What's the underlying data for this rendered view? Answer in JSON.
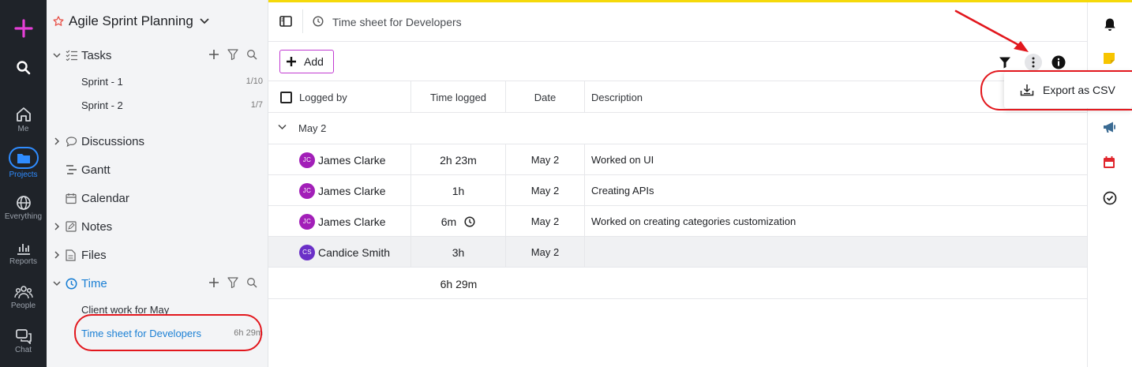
{
  "rail": [
    {
      "id": "new",
      "label": ""
    },
    {
      "id": "search",
      "label": ""
    },
    {
      "id": "me",
      "label": "Me"
    },
    {
      "id": "projects",
      "label": "Projects"
    },
    {
      "id": "everything",
      "label": "Everything"
    },
    {
      "id": "reports",
      "label": "Reports"
    },
    {
      "id": "people",
      "label": "People"
    },
    {
      "id": "chat",
      "label": "Chat"
    }
  ],
  "sidebar": {
    "project_title": "Agile Sprint Planning",
    "tasks_label": "Tasks",
    "sprint1": {
      "label": "Sprint - 1",
      "count": "1/10"
    },
    "sprint2": {
      "label": "Sprint - 2",
      "count": "1/7"
    },
    "discussions_label": "Discussions",
    "gantt_label": "Gantt",
    "calendar_label": "Calendar",
    "notes_label": "Notes",
    "files_label": "Files",
    "time_label": "Time",
    "time_items": [
      {
        "label": "Client work for May",
        "count": ""
      },
      {
        "label": "Time sheet for Developers",
        "count": "6h 29m"
      }
    ]
  },
  "main": {
    "breadcrumb_title": "Time sheet for Developers",
    "add_label": "Add",
    "columns": {
      "logged_by": "Logged by",
      "time_logged": "Time logged",
      "date": "Date",
      "description": "Description"
    },
    "group_label": "May 2",
    "rows": [
      {
        "initials": "JC",
        "name": "James Clarke",
        "time": "2h 23m",
        "date": "May 2",
        "description": "Worked on UI"
      },
      {
        "initials": "JC",
        "name": "James Clarke",
        "time": "1h",
        "date": "May 2",
        "description": "Creating APIs"
      },
      {
        "initials": "JC",
        "name": "James Clarke",
        "time": "6m",
        "date": "May 2",
        "description": "Worked on creating categories customization"
      },
      {
        "initials": "CS",
        "name": "Candice Smith",
        "time": "3h",
        "date": "May 2",
        "description": ""
      }
    ],
    "total": "6h 29m"
  },
  "menu": {
    "export_label": "Export as CSV"
  },
  "colors": {
    "accent": "#1a7fd4",
    "add_border": "#c13ad1",
    "annotation": "#e2171d",
    "topbar": "#f5d90a"
  }
}
